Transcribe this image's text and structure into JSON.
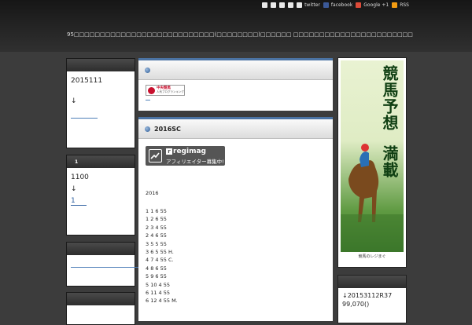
{
  "topnav": {
    "items": [
      {
        "icon": "home-icon",
        "label": ""
      },
      {
        "icon": "person-icon",
        "label": ""
      },
      {
        "icon": "mail-icon",
        "label": ""
      },
      {
        "icon": "print-icon",
        "label": ""
      },
      {
        "icon": "twitter-icon",
        "label": "twitter"
      },
      {
        "icon": "facebook-icon",
        "label": "facebook"
      },
      {
        "icon": "google-plus-icon",
        "label": "Google +1"
      },
      {
        "icon": "rss-icon",
        "label": "RSS"
      }
    ]
  },
  "site": {
    "title": "95□□□□□□□□□□□□□□□□□□□□□□□□□□□(□□□□□□□□)□□□□□□ □□□□□□□□□□□□□□□□□□□□□□□□□□□□"
  },
  "left_sidebar": {
    "widget1": {
      "title": "",
      "date": "2015111",
      "arrow": "↓"
    },
    "widget2": {
      "title": "1",
      "value": "1100",
      "arrow": "↓",
      "link": "1"
    },
    "widget3": {
      "title": ""
    },
    "widget4": {
      "title": ""
    }
  },
  "main": {
    "post1": {
      "title": "",
      "banner_line1": "中央競馬",
      "banner_line2": "人気ブログランキング"
    },
    "post2": {
      "title": "2016SC",
      "badge_brand": "regimag",
      "badge_sub": "アフィリエイター募集中!",
      "year": "2016",
      "entries": [
        "1 1  6 55",
        "1 2  6 55",
        "2 3  4 55",
        "2 4  6 55",
        "3 5  5 55",
        "3 6  5 55 H.",
        "4 7  4 55 C.",
        "4 8  6 55",
        "5 9  6 55",
        "5 10  4 55",
        "6 11  4 55",
        "6 12  4 55 M."
      ]
    }
  },
  "right_sidebar": {
    "ad": {
      "text1": "競馬予想",
      "text2": "満載",
      "caption": "競馬のレジまぐ"
    },
    "widget": {
      "title": "",
      "line1": "↓20153112R37",
      "line2": "99,070()"
    }
  },
  "colors": {
    "accent": "#4b73a3",
    "link": "#2d5fa0",
    "header_bg": "#1e1e1e",
    "body_bg": "#3c3c3c"
  }
}
